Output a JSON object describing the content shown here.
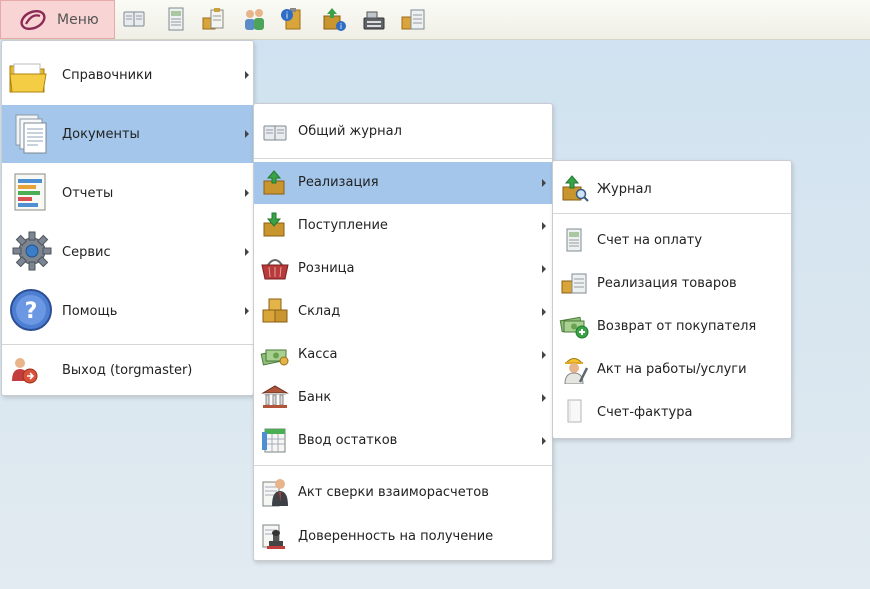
{
  "toolbar": {
    "menu_label": "Меню",
    "icons": [
      "journal-icon",
      "invoice-icon",
      "clipboard-icon",
      "users-icon",
      "info-clipboard-icon",
      "package-info-icon",
      "cash-register-icon",
      "box-document-icon"
    ]
  },
  "main_menu": {
    "items": [
      {
        "label": "Справочники",
        "icon": "folder-icon"
      },
      {
        "label": "Документы",
        "icon": "documents-icon"
      },
      {
        "label": "Отчеты",
        "icon": "report-icon"
      },
      {
        "label": "Сервис",
        "icon": "gear-icon"
      },
      {
        "label": "Помощь",
        "icon": "help-icon"
      },
      {
        "label": "Выход (torgmaster)",
        "icon": "exit-icon"
      }
    ]
  },
  "documents_menu": {
    "items": [
      {
        "label": "Общий журнал",
        "icon": "journal-icon"
      },
      {
        "label": "Реализация",
        "icon": "box-up-icon"
      },
      {
        "label": "Поступление",
        "icon": "box-down-icon"
      },
      {
        "label": "Розница",
        "icon": "basket-icon"
      },
      {
        "label": "Склад",
        "icon": "boxes-icon"
      },
      {
        "label": "Касса",
        "icon": "money-icon"
      },
      {
        "label": "Банк",
        "icon": "bank-icon"
      },
      {
        "label": "Ввод остатков",
        "icon": "table-icon"
      },
      {
        "label": "Акт сверки взаиморасчетов",
        "icon": "person-doc-icon"
      },
      {
        "label": "Доверенность на получение",
        "icon": "stamp-icon"
      }
    ]
  },
  "sales_menu": {
    "items": [
      {
        "label": "Журнал",
        "icon": "box-search-icon"
      },
      {
        "label": "Счет на оплату",
        "icon": "invoice-icon"
      },
      {
        "label": "Реализация товаров",
        "icon": "goods-icon"
      },
      {
        "label": "Возврат от покупателя",
        "icon": "money-return-icon"
      },
      {
        "label": "Акт на работы/услуги",
        "icon": "worker-icon"
      },
      {
        "label": "Счет-фактура",
        "icon": "blank-doc-icon"
      }
    ]
  },
  "colors": {
    "highlight": "#a3c6ea",
    "menu_button_bg": "#f8d4d4",
    "logo": "#8a2a55"
  }
}
